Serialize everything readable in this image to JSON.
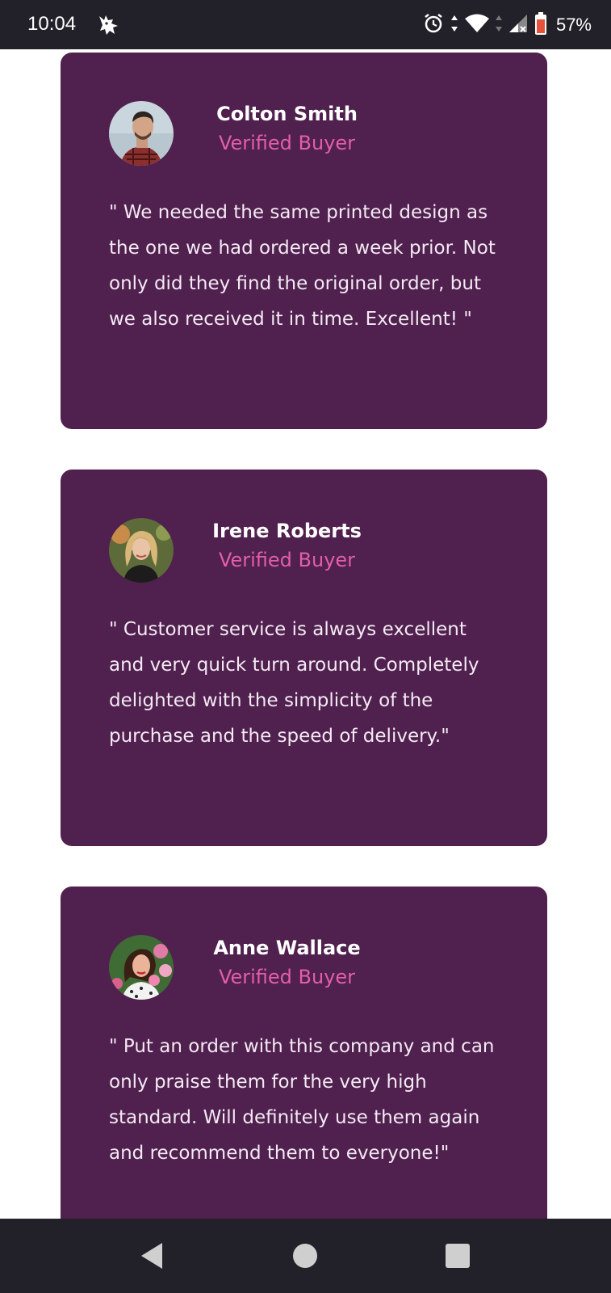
{
  "status_bar": {
    "time": "10:04",
    "app_icon": "cat-app-icon",
    "icons": [
      "alarm-icon",
      "data-arrows-icon",
      "wifi-icon",
      "signal-icon",
      "battery-icon"
    ],
    "battery": "57%"
  },
  "testimonials": [
    {
      "name": "Colton Smith",
      "badge": "Verified Buyer",
      "quote": "\" We needed the same printed design as the one we had ordered a week prior. Not only did they find the original order, but we also received it in time. Excellent! \""
    },
    {
      "name": "Irene Roberts",
      "badge": "Verified Buyer",
      "quote": "\" Customer service is always excellent and very quick turn around. Completely delighted with the simplicity of the purchase and the speed of delivery.\""
    },
    {
      "name": "Anne Wallace",
      "badge": "Verified Buyer",
      "quote": "\" Put an order with this company and can only praise them for the very high standard. Will definitely use them again and recommend them to everyone!\""
    }
  ],
  "nav_bar": {
    "icons": [
      "back-icon",
      "home-icon",
      "recents-icon"
    ]
  },
  "colors": {
    "card_bg": "#50204f",
    "badge": "#e25fa8",
    "status_bar": "#222129"
  }
}
